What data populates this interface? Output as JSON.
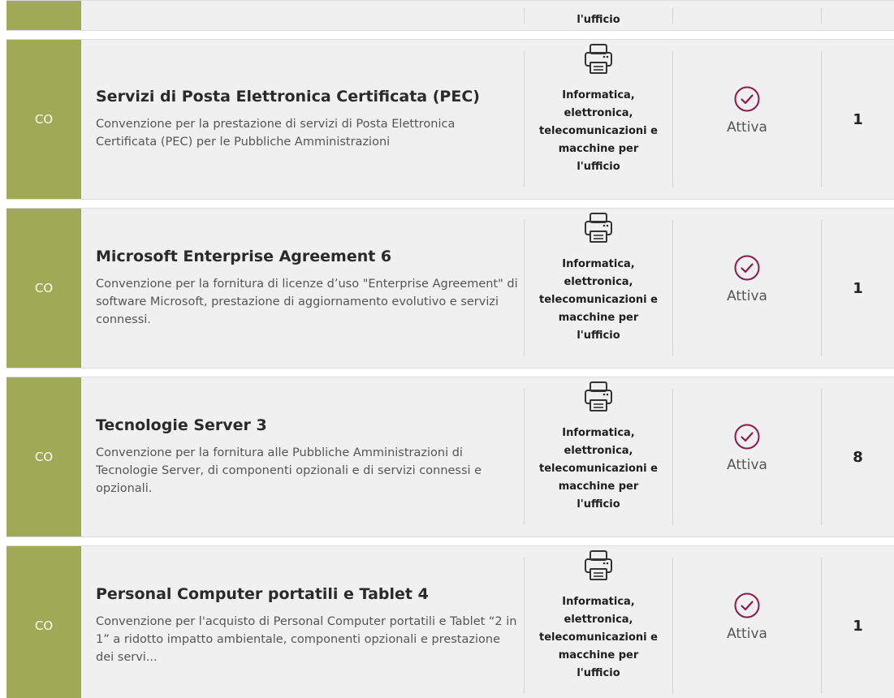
{
  "colors": {
    "badge_bg": "#9eaa55",
    "status_icon": "#8a1c4a",
    "row_bg": "#f0f0f0"
  },
  "partial_row": {
    "category_tail": "l'ufficio"
  },
  "rows": [
    {
      "badge": "CO",
      "title": "Servizi di Posta Elettronica Certificata (PEC)",
      "description": "Convenzione per la prestazione di servizi di Posta Elettronica Certificata (PEC) per le Pubbliche Amministrazioni",
      "category_icon": "printer-icon",
      "category_lines": [
        "Informatica,",
        "elettronica,",
        "telecomunicazioni e",
        "macchine per",
        "l'ufficio"
      ],
      "status_icon": "check-circle-icon",
      "status": "Attiva",
      "count": "1"
    },
    {
      "badge": "CO",
      "title": "Microsoft Enterprise Agreement 6",
      "description": "Convenzione per la fornitura di licenze d’uso \"Enterprise Agreement\" di software Microsoft, prestazione di aggiornamento evolutivo e servizi connessi.",
      "category_icon": "printer-icon",
      "category_lines": [
        "Informatica,",
        "elettronica,",
        "telecomunicazioni e",
        "macchine per",
        "l'ufficio"
      ],
      "status_icon": "check-circle-icon",
      "status": "Attiva",
      "count": "1"
    },
    {
      "badge": "CO",
      "title": "Tecnologie Server 3",
      "description": "Convenzione per la fornitura alle Pubbliche Amministrazioni di Tecnologie Server, di componenti opzionali e di servizi connessi e opzionali.",
      "category_icon": "printer-icon",
      "category_lines": [
        "Informatica,",
        "elettronica,",
        "telecomunicazioni e",
        "macchine per",
        "l'ufficio"
      ],
      "status_icon": "check-circle-icon",
      "status": "Attiva",
      "count": "8"
    },
    {
      "badge": "CO",
      "title": "Personal Computer portatili e Tablet 4",
      "description": "Convenzione per l'acquisto di Personal Computer portatili e Tablet “2 in 1” a ridotto impatto ambientale, componenti opzionali e prestazione dei servi...",
      "category_icon": "printer-icon",
      "category_lines": [
        "Informatica,",
        "elettronica,",
        "telecomunicazioni e",
        "macchine per",
        "l'ufficio"
      ],
      "status_icon": "check-circle-icon",
      "status": "Attiva",
      "count": "1"
    }
  ]
}
